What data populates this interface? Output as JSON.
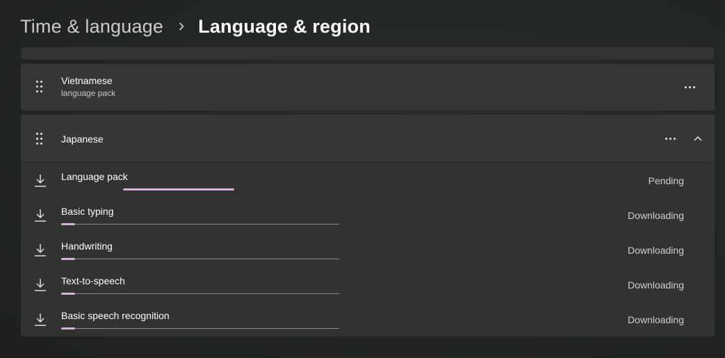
{
  "breadcrumb": {
    "parent": "Time & language",
    "current": "Language & region"
  },
  "languages": [
    {
      "name": "Vietnamese",
      "subtitle": "language pack"
    },
    {
      "name": "Japanese"
    }
  ],
  "features": [
    {
      "name": "Language pack",
      "status": "Pending",
      "progress": "indeterminate"
    },
    {
      "name": "Basic typing",
      "status": "Downloading",
      "progress": 0.05
    },
    {
      "name": "Handwriting",
      "status": "Downloading",
      "progress": 0.05
    },
    {
      "name": "Text-to-speech",
      "status": "Downloading",
      "progress": 0.05
    },
    {
      "name": "Basic speech recognition",
      "status": "Downloading",
      "progress": 0.05
    }
  ],
  "icons": {
    "breadcrumb_separator": "chevron-right-icon",
    "drag": "drag-handle-icon",
    "more": "more-options-icon",
    "collapse": "chevron-up-icon",
    "download": "download-icon"
  },
  "colors": {
    "accent": "#e3a8e8",
    "background": "#232724",
    "card": "#343734"
  }
}
